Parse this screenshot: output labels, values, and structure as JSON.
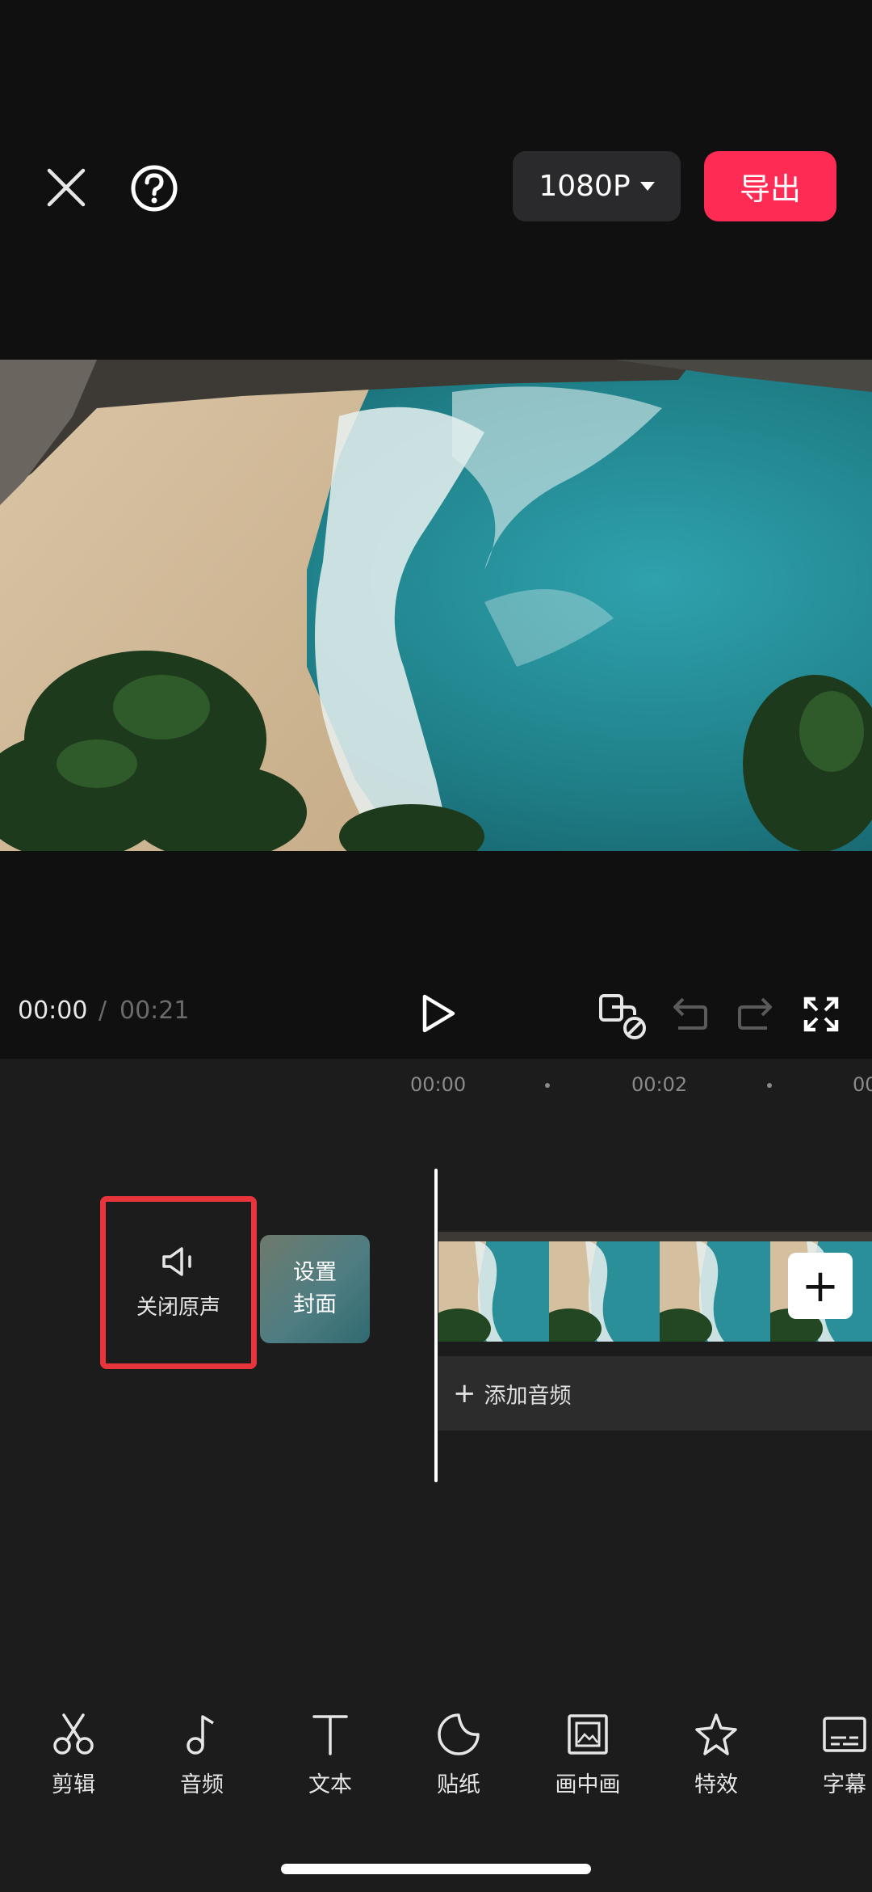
{
  "header": {
    "close_icon": "close-icon",
    "help_icon": "help-icon",
    "resolution": "1080P",
    "export_label": "导出"
  },
  "playback": {
    "current_time": "00:00",
    "separator": "/",
    "total_time": "00:21",
    "play_icon": "play-icon",
    "keyframe_icon": "keyframe-icon",
    "undo_icon": "undo-icon",
    "redo_icon": "redo-icon",
    "fullscreen_icon": "fullscreen-icon"
  },
  "timeline": {
    "ruler": [
      "00:00",
      "00:02",
      "00"
    ],
    "mute_label": "关闭原声",
    "cover_line1": "设置",
    "cover_line2": "封面",
    "add_audio_label": "添加音频",
    "add_clip_symbol": "+"
  },
  "toolbar": {
    "items": [
      {
        "label": "剪辑",
        "icon": "scissors-icon"
      },
      {
        "label": "音频",
        "icon": "music-note-icon"
      },
      {
        "label": "文本",
        "icon": "text-icon"
      },
      {
        "label": "贴纸",
        "icon": "sticker-icon"
      },
      {
        "label": "画中画",
        "icon": "picture-in-picture-icon"
      },
      {
        "label": "特效",
        "icon": "effects-star-icon"
      },
      {
        "label": "字幕",
        "icon": "subtitle-icon"
      }
    ]
  },
  "colors": {
    "background": "#101010",
    "panel": "#1c1c1c",
    "export_red": "#fe2c55",
    "highlight_border": "#e8353b"
  }
}
